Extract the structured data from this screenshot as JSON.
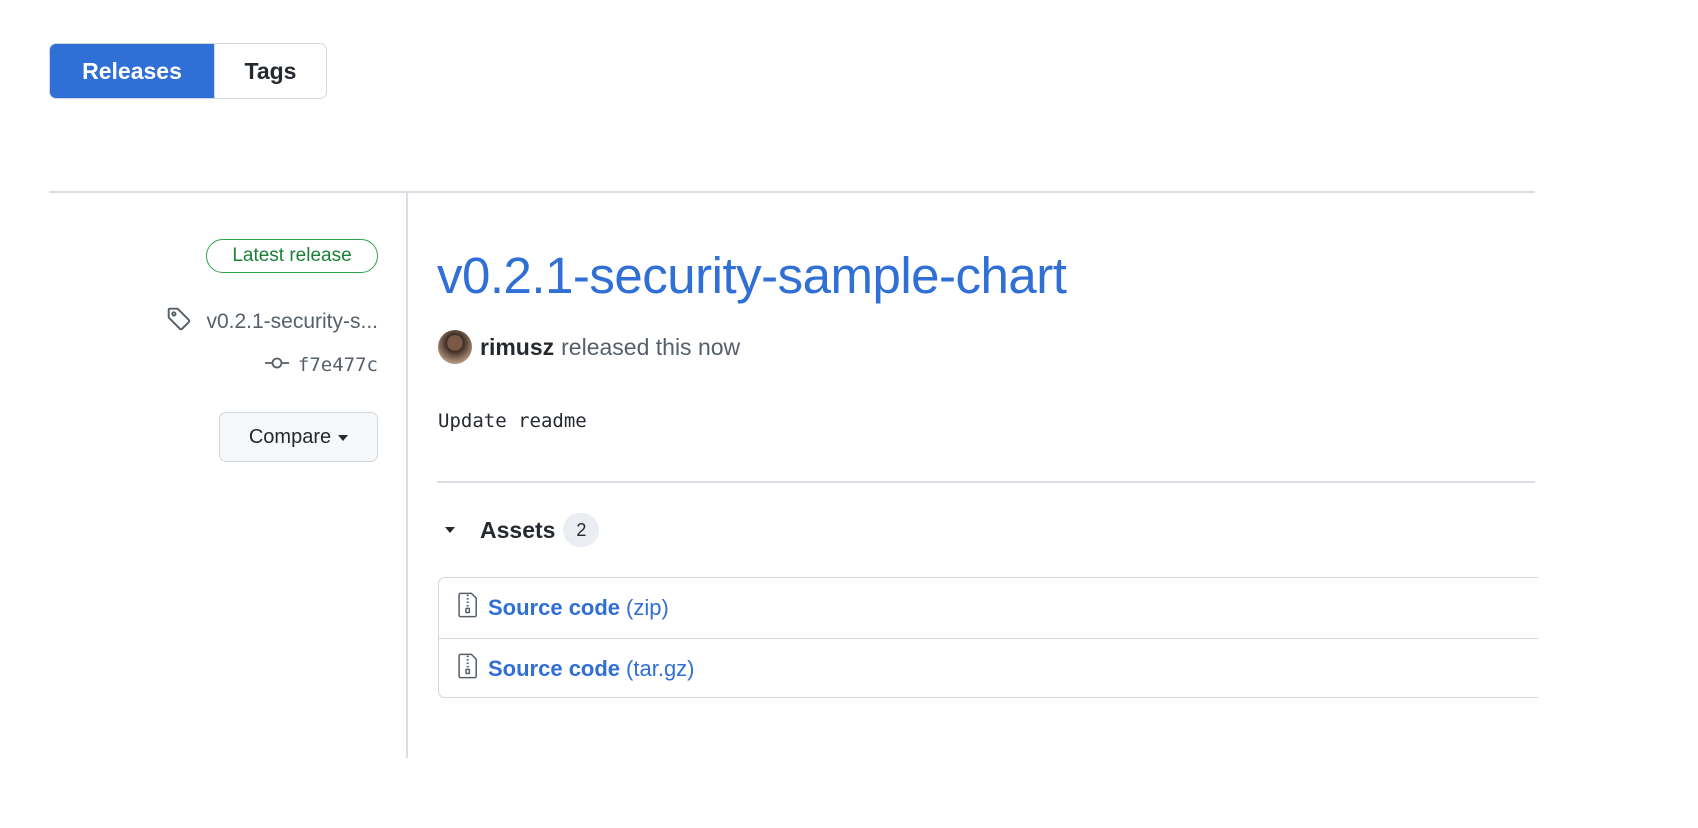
{
  "tabs": {
    "releases_label": "Releases",
    "tags_label": "Tags",
    "active": "Releases"
  },
  "sidebar": {
    "badge": "Latest release",
    "tag_name": "v0.2.1-security-s...",
    "commit": "f7e477c",
    "compare_label": "Compare",
    "icons": [
      "tag-icon",
      "git-commit-icon",
      "caret-down-icon"
    ]
  },
  "release": {
    "title": "v0.2.1-security-sample-chart",
    "author": "rimusz",
    "byline_suffix": "released this now",
    "notes": "Update readme"
  },
  "assets": {
    "label": "Assets",
    "count": "2",
    "items": [
      {
        "name": "Source code",
        "ext": "(zip)",
        "icon": "file-zip-icon"
      },
      {
        "name": "Source code",
        "ext": "(tar.gz)",
        "icon": "file-zip-icon"
      }
    ]
  },
  "colors": {
    "accent": "#2f6fd6",
    "badge_green": "#1a7f37",
    "border": "#d0d7de",
    "muted_text": "#57606a"
  }
}
